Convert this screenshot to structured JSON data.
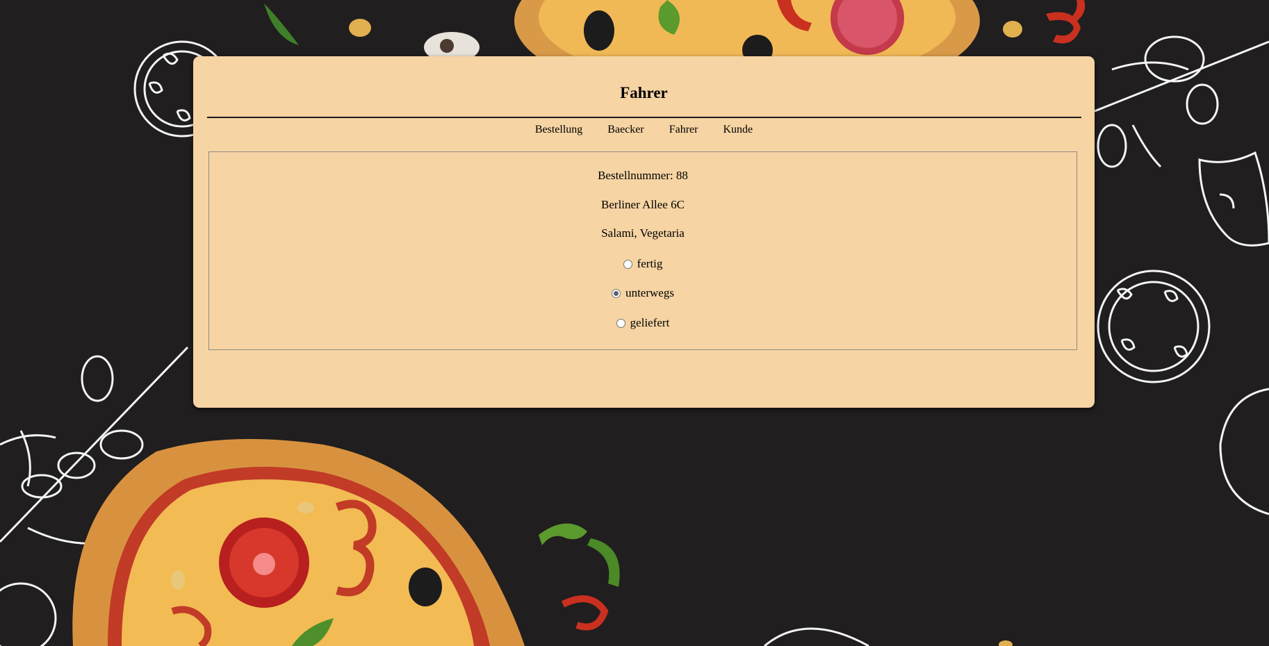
{
  "page": {
    "title": "Fahrer"
  },
  "nav": {
    "items": [
      {
        "label": "Bestellung"
      },
      {
        "label": "Baecker"
      },
      {
        "label": "Fahrer"
      },
      {
        "label": "Kunde"
      }
    ]
  },
  "order": {
    "number_line": "Bestellnummer: 88",
    "address": "Berliner Allee 6C",
    "pizzas": "Salami, Vegetaria",
    "status_options": [
      {
        "label": "fertig",
        "checked": false
      },
      {
        "label": "unterwegs",
        "checked": true
      },
      {
        "label": "geliefert",
        "checked": false
      }
    ]
  },
  "colors": {
    "background": "#201e1f",
    "card": "#f6d4a3",
    "radio_selected": "#5a5f73"
  }
}
